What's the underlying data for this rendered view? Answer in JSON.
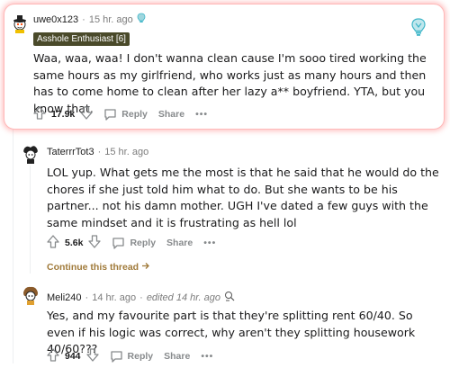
{
  "comments": [
    {
      "username": "uwe0x123",
      "time": "15 hr. ago",
      "flair": "Asshole Enthusiast [6]",
      "body": "Waa, waa, waa! I don't wanna clean cause I'm sooo tired working the same hours as my girlfriend, who works just as many hours and then has to come home to clean after her lazy a** boyfriend. YTA, but you know that.",
      "votes": "17.9k",
      "reply_label": "Reply",
      "share_label": "Share",
      "more_label": "•••"
    },
    {
      "username": "TaterrrTot3",
      "time": "15 hr. ago",
      "body": "LOL yup. What gets me the most is that he said that he would do the chores if she just told him what to do. But she wants to be his partner... not his damn mother. UGH I've dated a few guys with the same mindset and it is frustrating as hell lol",
      "votes": "5.6k",
      "reply_label": "Reply",
      "share_label": "Share",
      "more_label": "•••",
      "continue_label": "Continue this thread"
    },
    {
      "username": "Meli240",
      "time": "14 hr. ago",
      "edited": "edited 14 hr. ago",
      "body": "Yes, and my favourite part is that they're splitting rent 60/40. So even if his logic was correct, why aren't they splitting housework 40/60???",
      "votes": "944",
      "reply_label": "Reply",
      "share_label": "Share",
      "more_label": "•••"
    }
  ],
  "colors": {
    "highlight_border": "#ffb8b8",
    "flair_bg": "#4a4a2a",
    "continue_link": "#a07a3a",
    "award_blue": "#3fb6c8"
  },
  "icons": [
    "upvote-icon",
    "downvote-icon",
    "reply-icon",
    "award-icon",
    "edit-icon"
  ]
}
